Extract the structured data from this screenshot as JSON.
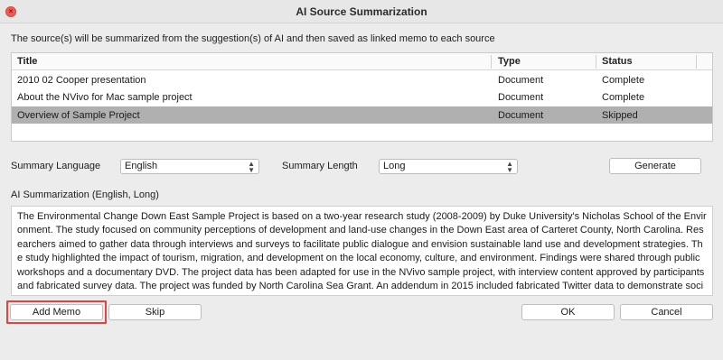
{
  "window": {
    "title": "AI Source Summarization"
  },
  "intro_text": "The source(s) will be summarized from the suggestion(s) of AI and then saved as linked memo to each source",
  "table": {
    "columns": [
      "Title",
      "Type",
      "Status"
    ],
    "rows": [
      {
        "title": "2010 02 Cooper presentation",
        "type": "Document",
        "status": "Complete"
      },
      {
        "title": "About the NVivo for Mac sample project",
        "type": "Document",
        "status": "Complete"
      },
      {
        "title": "Overview of Sample Project",
        "type": "Document",
        "status": "Skipped",
        "selected": true
      }
    ]
  },
  "controls": {
    "language_label": "Summary Language",
    "language_value": "English",
    "length_label": "Summary Length",
    "length_value": "Long",
    "generate_label": "Generate"
  },
  "summary": {
    "heading": "AI Summarization (English, Long)",
    "text": "The Environmental Change Down East Sample Project is based on a two-year research study (2008-2009) by Duke University's Nicholas School of the Environment. The study focused on community perceptions of development and land-use changes in the Down East area of Carteret County, North Carolina. Researchers aimed to gather data through interviews and surveys to facilitate public dialogue and envision sustainable land use and development strategies. The study highlighted the impact of tourism, migration, and development on the local economy, culture, and environment. Findings were shared through public workshops and a documentary DVD. The project data has been adapted for use in the NVivo sample project, with interview content approved by participants and fabricated survey data. The project was funded by North Carolina Sea Grant. An addendum in 2015 included fabricated Twitter data to demonstrate social media analysis in NVivo for Mac."
  },
  "buttons": {
    "add_memo": "Add Memo",
    "skip": "Skip",
    "ok": "OK",
    "cancel": "Cancel"
  },
  "colors": {
    "highlight": "#e24343",
    "selected_row": "#b0b0b0",
    "close": "#ee5b56"
  }
}
